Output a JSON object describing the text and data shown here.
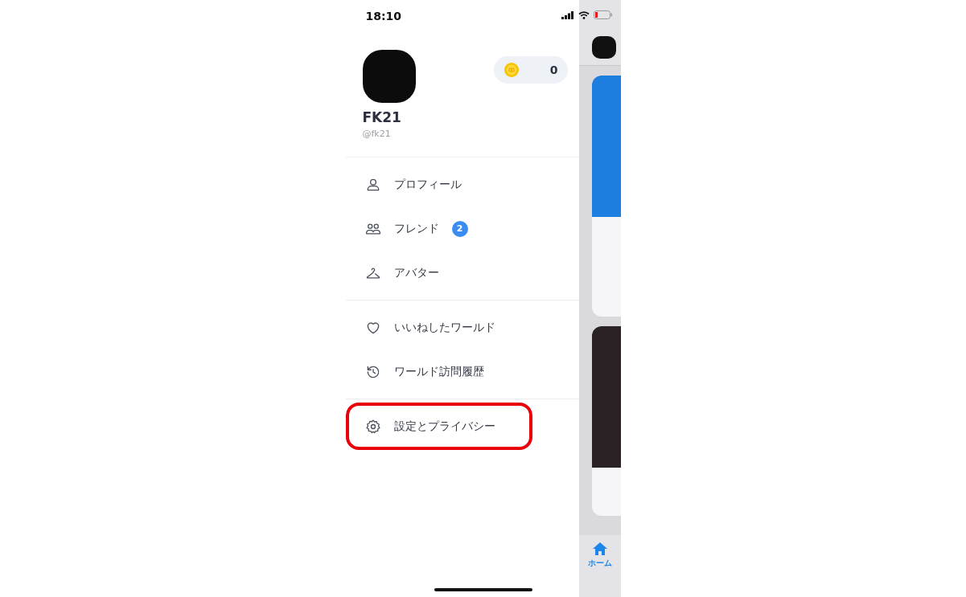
{
  "status_bar": {
    "time": "18:10"
  },
  "profile": {
    "name": "FK21",
    "handle": "@fk21",
    "coins": "0"
  },
  "menu_sections": [
    {
      "items": [
        {
          "kind": "person",
          "label": "プロフィール",
          "highlighted": false
        },
        {
          "kind": "people",
          "label": "フレンド",
          "badge": "2",
          "highlighted": false
        },
        {
          "kind": "hanger",
          "label": "アバター",
          "highlighted": false
        }
      ]
    },
    {
      "items": [
        {
          "kind": "heart",
          "label": "いいねしたワールド",
          "highlighted": false
        },
        {
          "kind": "history",
          "label": "ワールド訪問履歴",
          "highlighted": false
        }
      ]
    },
    {
      "items": [
        {
          "kind": "gear",
          "label": "設定とプライバシー",
          "highlighted": true
        }
      ]
    }
  ],
  "tab_bar": [
    {
      "label": "ホーム",
      "selected": true
    }
  ]
}
